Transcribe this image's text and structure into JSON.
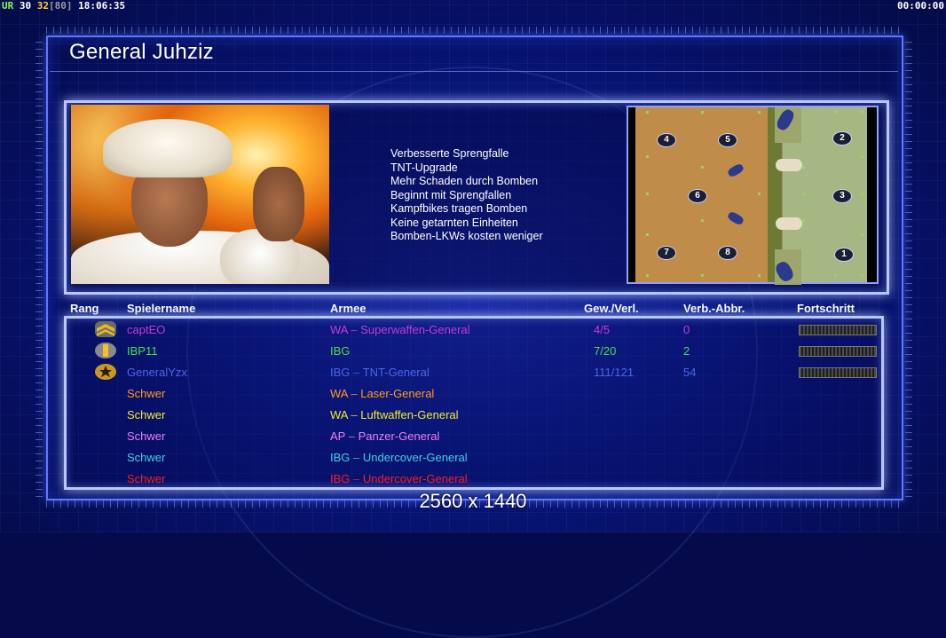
{
  "overlay": {
    "ur_label": "UR",
    "val_a": "30",
    "val_b": "32",
    "val_c": "[80]",
    "clock": "18:06:35",
    "timer": "00:00:00"
  },
  "screen": {
    "title": "General Juhziz",
    "resolution": "2560 x 1440"
  },
  "perks": [
    "Verbesserte Sprengfalle",
    "TNT-Upgrade",
    "Mehr Schaden durch Bomben",
    "Beginnt mit Sprengfallen",
    "Kampfbikes tragen Bomben",
    "Keine getarnten Einheiten",
    "Bomben-LKWs kosten weniger"
  ],
  "map": {
    "start_positions": [
      "1",
      "2",
      "3",
      "4",
      "5",
      "6",
      "7",
      "8"
    ]
  },
  "table": {
    "headers": {
      "rank": "Rang",
      "player": "Spielername",
      "army": "Armee",
      "winloss": "Gew./Verl.",
      "disconnect": "Verb.-Abbr.",
      "progress": "Fortschritt"
    },
    "rows": [
      {
        "name": "captEO",
        "faction": "WA",
        "sep": "–",
        "army": "Superwaffen-General",
        "wl": "4/5",
        "dc": "0",
        "color": "#c43cd6",
        "rank_icon": "chevron-rank-icon",
        "progress": 1.0
      },
      {
        "name": "IBP11",
        "faction": "IBG",
        "sep": "",
        "army": "",
        "wl": "7/20",
        "dc": "2",
        "color": "#45e04a",
        "rank_icon": "bar-rank-icon",
        "progress": 1.0
      },
      {
        "name": "GeneralYzx",
        "faction": "IBG",
        "sep": "–",
        "army": "TNT-General",
        "wl": "111/121",
        "dc": "54",
        "color": "#4a66e8",
        "rank_icon": "star-rank-icon",
        "progress": 1.0
      },
      {
        "name": "Schwer",
        "faction": "WA",
        "sep": "–",
        "army": "Laser-General",
        "wl": "",
        "dc": "",
        "color": "#ff9a1f",
        "rank_icon": "",
        "progress": null
      },
      {
        "name": "Schwer",
        "faction": "WA",
        "sep": "–",
        "army": "Luftwaffen-General",
        "wl": "",
        "dc": "",
        "color": "#f2ea2a",
        "rank_icon": "",
        "progress": null
      },
      {
        "name": "Schwer",
        "faction": "AP",
        "sep": "–",
        "army": "Panzer-General",
        "wl": "",
        "dc": "",
        "color": "#ee7ff2",
        "rank_icon": "",
        "progress": null
      },
      {
        "name": "Schwer",
        "faction": "IBG",
        "sep": "–",
        "army": "Undercover-General",
        "wl": "",
        "dc": "",
        "color": "#3fd0e6",
        "rank_icon": "",
        "progress": null
      },
      {
        "name": "Schwer",
        "faction": "IBG",
        "sep": "–",
        "army": "Undercover-General",
        "wl": "",
        "dc": "",
        "color": "#ff1e1e",
        "rank_icon": "",
        "progress": null
      }
    ]
  }
}
